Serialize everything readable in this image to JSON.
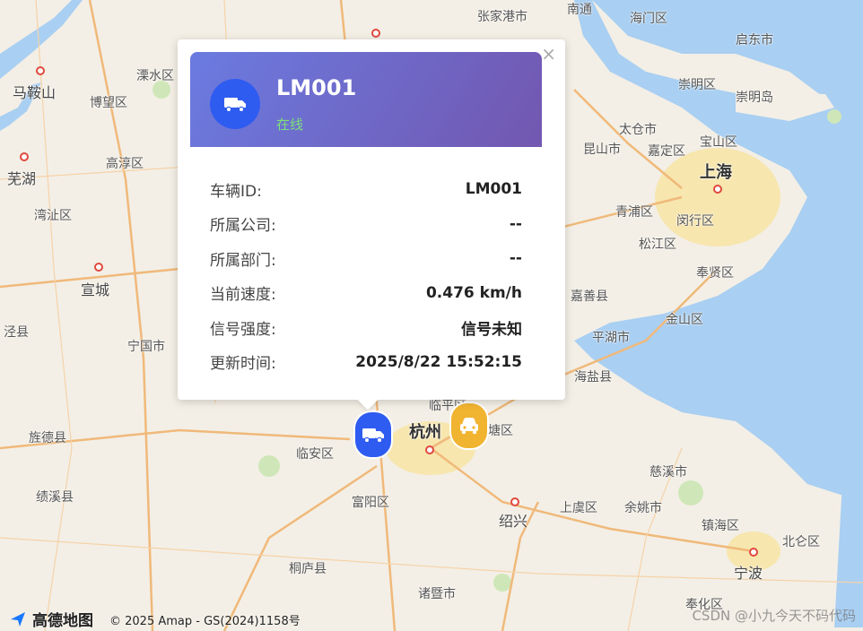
{
  "popup": {
    "close_symbol": "×",
    "vehicle_name": "LM001",
    "status": "在线",
    "icon": "truck-icon",
    "rows": [
      {
        "label": "车辆ID:",
        "value": "LM001"
      },
      {
        "label": "所属公司:",
        "value": "--"
      },
      {
        "label": "所属部门:",
        "value": "--"
      },
      {
        "label": "当前速度:",
        "value": "0.476 km/h"
      },
      {
        "label": "信号强度:",
        "value": "信号未知"
      },
      {
        "label": "更新时间:",
        "value": "2025/8/22 15:52:15"
      }
    ]
  },
  "map": {
    "labels": {
      "maanshan": "马鞍山",
      "bowang": "博望区",
      "lishui": "溧水区",
      "wuhu": "芜湖",
      "gaochun": "高淳区",
      "wanzhi": "湾沚区",
      "xuancheng": "宣城",
      "jingxian": "泾县",
      "ningguo": "宁国市",
      "jingde": "旌德县",
      "jixi": "绩溪县",
      "linan": "临安区",
      "hangzhou": "杭州",
      "fuyang": "富阳区",
      "tonglu": "桐庐县",
      "zhuji": "诸暨市",
      "shaoxing": "绍兴",
      "shangyu": "上虞区",
      "yuyao": "余姚市",
      "cixi": "慈溪市",
      "zhenhai": "镇海区",
      "beilun": "北仑区",
      "ningbo": "宁波",
      "fenghua": "奉化区",
      "haiyan": "海盐县",
      "pinghu": "平湖市",
      "jinshan": "金山区",
      "jiashan": "嘉善县",
      "fengxian": "奉贤区",
      "songjiang": "松江区",
      "minhang": "闵行区",
      "qingpu": "青浦区",
      "kunshan": "昆山市",
      "jiading": "嘉定区",
      "taicang": "太仓市",
      "baoshan": "宝山区",
      "shanghai": "上海",
      "chongming": "崇明岛",
      "qidong": "启东市",
      "haimen": "海门区",
      "tinghu": "崇明区",
      "zhangjiagang": "张家港市",
      "nantong": "南通",
      "linping": "临平区",
      "jiaxing_tang": "塘区"
    }
  },
  "footer": {
    "amap_brand": "高德地图",
    "copyright": "© 2025 Amap - GS(2024)1158号",
    "watermark": "CSDN @小九今天不码代码"
  },
  "colors": {
    "sea": "#a9cff2",
    "land": "#f3efe6",
    "urban": "#f7e3a0",
    "road": "#f0b97a",
    "header_start": "#6b7be0",
    "header_end": "#7257b0",
    "status_green": "#7ee07a",
    "marker_blue": "#2f5cf0",
    "marker_orange": "#f1b430"
  }
}
